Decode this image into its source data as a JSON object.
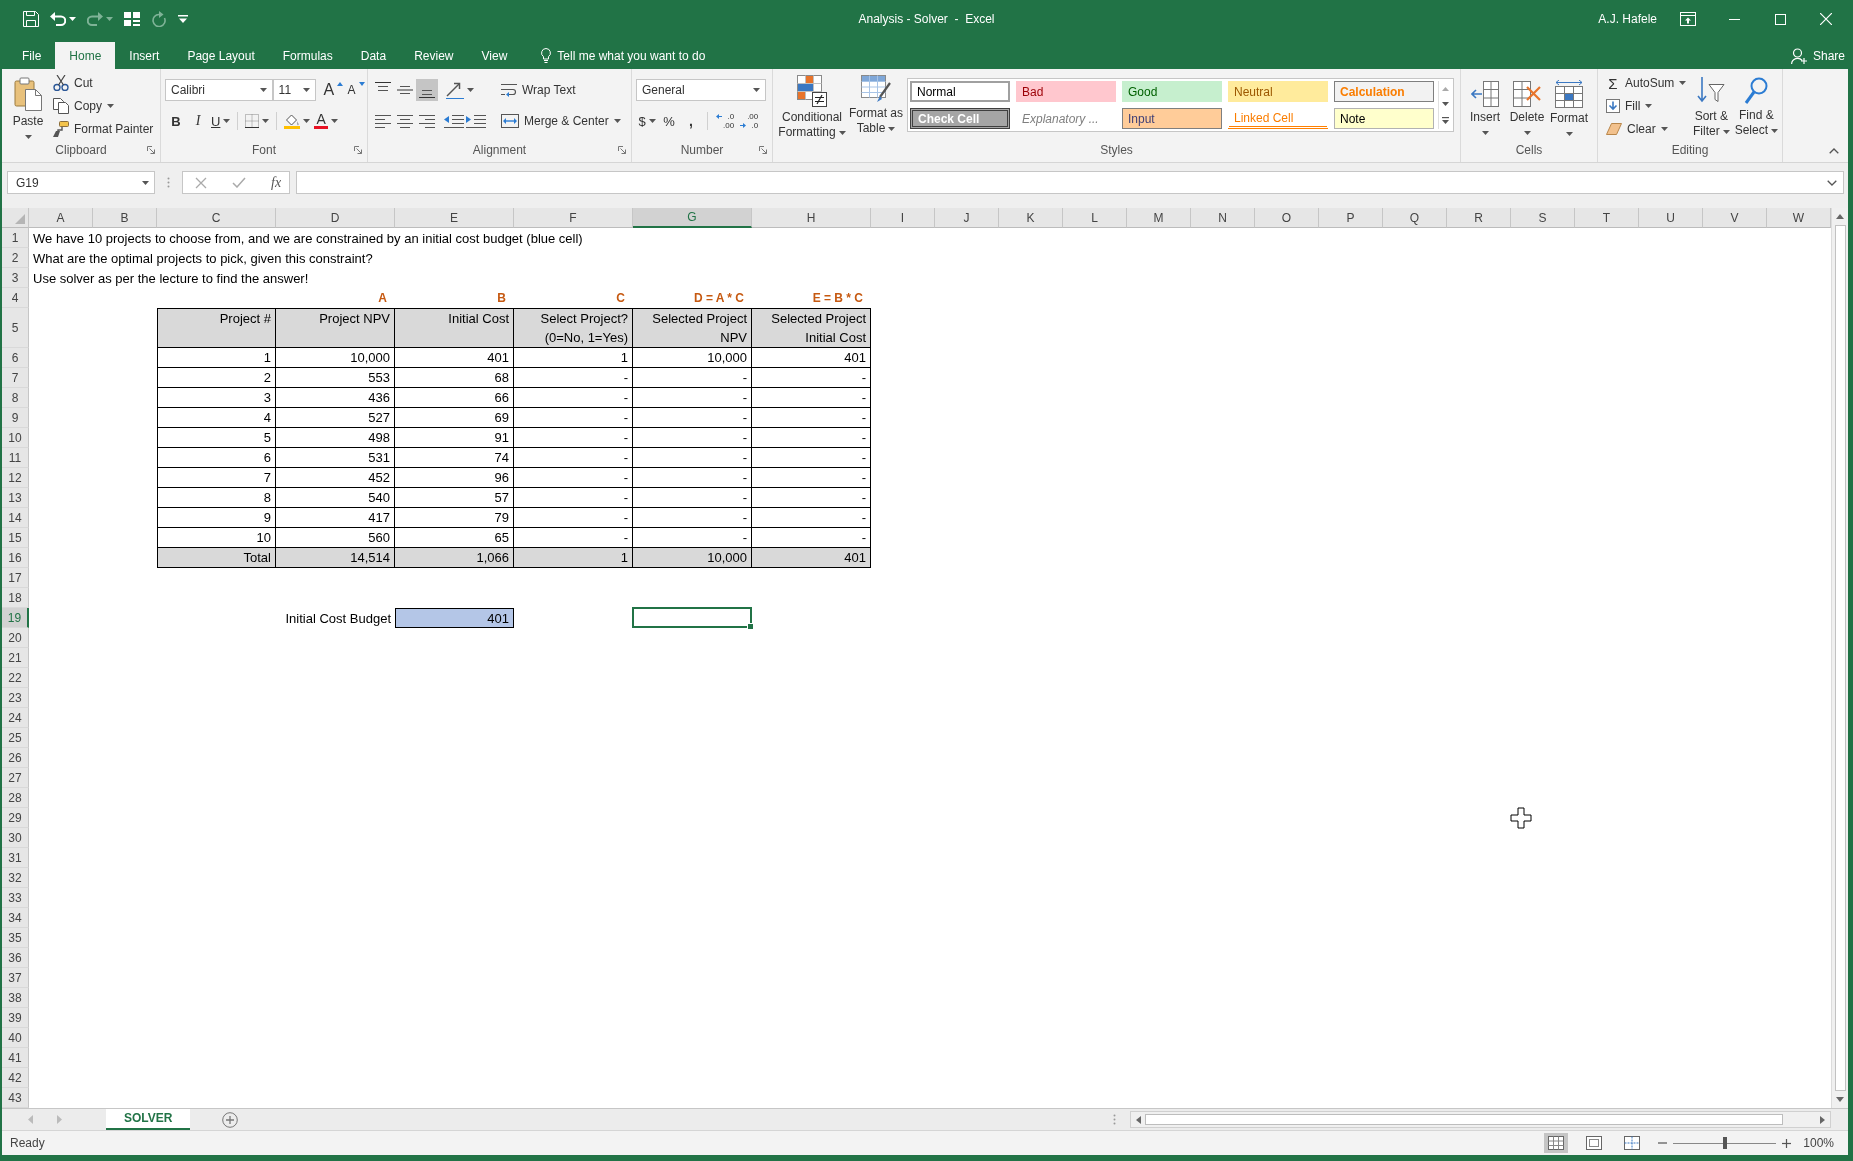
{
  "window": {
    "title": "Analysis - Solver  -  Excel",
    "user": "A.J. Hafele"
  },
  "quick_access": [
    {
      "kind": "save",
      "disabled": false
    },
    {
      "kind": "undo",
      "disabled": false
    },
    {
      "kind": "redo",
      "disabled": true
    },
    {
      "kind": "touch",
      "disabled": false
    },
    {
      "kind": "repeat",
      "disabled": true
    },
    {
      "kind": "customize",
      "disabled": false
    }
  ],
  "ribbon_tabs": [
    {
      "label": "File",
      "selected": false
    },
    {
      "label": "Home",
      "selected": true
    },
    {
      "label": "Insert",
      "selected": false
    },
    {
      "label": "Page Layout",
      "selected": false
    },
    {
      "label": "Formulas",
      "selected": false
    },
    {
      "label": "Data",
      "selected": false
    },
    {
      "label": "Review",
      "selected": false
    },
    {
      "label": "View",
      "selected": false
    }
  ],
  "tell_me": {
    "placeholder": "Tell me what you want to do"
  },
  "share": "Share",
  "ribbon": {
    "clipboard": {
      "label": "Clipboard",
      "paste": "Paste",
      "cut": "Cut",
      "copy": "Copy",
      "format_painter": "Format Painter"
    },
    "font": {
      "label": "Font",
      "font_name": "Calibri",
      "font_size": "11",
      "grow_font": "A",
      "shrink_font": "A",
      "bold": "B",
      "italic": "I",
      "underline": "U",
      "font_color": "A"
    },
    "alignment": {
      "label": "Alignment",
      "vertical": [
        {
          "kind": "top",
          "selected": false
        },
        {
          "kind": "middle",
          "selected": false
        },
        {
          "kind": "bottom",
          "selected": true
        }
      ],
      "horizontal": [
        {
          "kind": "left",
          "selected": false
        },
        {
          "kind": "center",
          "selected": false
        },
        {
          "kind": "right",
          "selected": false
        }
      ],
      "wrap_text": "Wrap Text",
      "merge_center": "Merge & Center"
    },
    "number": {
      "label": "Number",
      "format": "General",
      "currency": "$",
      "percent": "%",
      "comma": ",",
      "increase_decimal": [
        ".0",
        ".00"
      ],
      "decrease_decimal": [
        ".00",
        ".0"
      ]
    },
    "styles": {
      "label": "Styles",
      "conditional_formatting": "Conditional Formatting",
      "format_as_table": "Format as Table",
      "gallery": [
        {
          "label": "Normal",
          "kind": "normal",
          "selected": true
        },
        {
          "label": "Bad",
          "kind": "bad",
          "selected": false
        },
        {
          "label": "Good",
          "kind": "good",
          "selected": false
        },
        {
          "label": "Neutral",
          "kind": "neutral",
          "selected": false
        },
        {
          "label": "Calculation",
          "kind": "calculation",
          "selected": false
        },
        {
          "label": "Check Cell",
          "kind": "check",
          "selected": false
        },
        {
          "label": "Explanatory ...",
          "kind": "explanatory",
          "selected": false
        },
        {
          "label": "Input",
          "kind": "input",
          "selected": false
        },
        {
          "label": "Linked Cell",
          "kind": "linked",
          "selected": false
        },
        {
          "label": "Note",
          "kind": "note",
          "selected": false
        }
      ]
    },
    "cells": {
      "label": "Cells",
      "buttons": [
        {
          "kind": "insert",
          "label": "Insert"
        },
        {
          "kind": "delete",
          "label": "Delete"
        },
        {
          "kind": "format",
          "label": "Format"
        }
      ]
    },
    "editing": {
      "label": "Editing",
      "autosum_symbol": "Σ",
      "autosum": "AutoSum",
      "fill": "Fill",
      "clear": "Clear",
      "sort_filter": "Sort & Filter",
      "find_select": "Find & Select"
    }
  },
  "formula_bar": {
    "name_box": "G19",
    "function_button": "fx"
  },
  "sheet": {
    "columns": [
      {
        "label": "A",
        "selected": false
      },
      {
        "label": "B",
        "selected": false
      },
      {
        "label": "C",
        "selected": false
      },
      {
        "label": "D",
        "selected": false
      },
      {
        "label": "E",
        "selected": false
      },
      {
        "label": "F",
        "selected": false
      },
      {
        "label": "G",
        "selected": true
      },
      {
        "label": "H",
        "selected": false
      },
      {
        "label": "I",
        "selected": false
      },
      {
        "label": "J",
        "selected": false
      },
      {
        "label": "K",
        "selected": false
      },
      {
        "label": "L",
        "selected": false
      },
      {
        "label": "M",
        "selected": false
      },
      {
        "label": "N",
        "selected": false
      },
      {
        "label": "O",
        "selected": false
      },
      {
        "label": "P",
        "selected": false
      },
      {
        "label": "Q",
        "selected": false
      },
      {
        "label": "R",
        "selected": false
      },
      {
        "label": "S",
        "selected": false
      },
      {
        "label": "T",
        "selected": false
      },
      {
        "label": "U",
        "selected": false
      },
      {
        "label": "V",
        "selected": false
      },
      {
        "label": "W",
        "selected": false
      }
    ],
    "rows": [
      {
        "label": "1",
        "selected": false
      },
      {
        "label": "2",
        "selected": false
      },
      {
        "label": "3",
        "selected": false
      },
      {
        "label": "4",
        "selected": false
      },
      {
        "label": "5",
        "selected": false
      },
      {
        "label": "6",
        "selected": false
      },
      {
        "label": "7",
        "selected": false
      },
      {
        "label": "8",
        "selected": false
      },
      {
        "label": "9",
        "selected": false
      },
      {
        "label": "10",
        "selected": false
      },
      {
        "label": "11",
        "selected": false
      },
      {
        "label": "12",
        "selected": false
      },
      {
        "label": "13",
        "selected": false
      },
      {
        "label": "14",
        "selected": false
      },
      {
        "label": "15",
        "selected": false
      },
      {
        "label": "16",
        "selected": false
      },
      {
        "label": "17",
        "selected": false
      },
      {
        "label": "18",
        "selected": false
      },
      {
        "label": "19",
        "selected": true
      },
      {
        "label": "20",
        "selected": false
      },
      {
        "label": "21",
        "selected": false
      },
      {
        "label": "22",
        "selected": false
      },
      {
        "label": "23",
        "selected": false
      },
      {
        "label": "24",
        "selected": false
      },
      {
        "label": "25",
        "selected": false
      },
      {
        "label": "26",
        "selected": false
      },
      {
        "label": "27",
        "selected": false
      },
      {
        "label": "28",
        "selected": false
      },
      {
        "label": "29",
        "selected": false
      },
      {
        "label": "30",
        "selected": false
      },
      {
        "label": "31",
        "selected": false
      },
      {
        "label": "32",
        "selected": false
      },
      {
        "label": "33",
        "selected": false
      },
      {
        "label": "34",
        "selected": false
      },
      {
        "label": "35",
        "selected": false
      },
      {
        "label": "36",
        "selected": false
      },
      {
        "label": "37",
        "selected": false
      },
      {
        "label": "38",
        "selected": false
      },
      {
        "label": "39",
        "selected": false
      },
      {
        "label": "40",
        "selected": false
      },
      {
        "label": "41",
        "selected": false
      },
      {
        "label": "42",
        "selected": false
      },
      {
        "label": "43",
        "selected": false
      }
    ],
    "notes": [
      "We have 10 projects to choose from, and we are constrained by an initial cost budget (blue cell)",
      "What are the optimal projects to pick, given this constraint?",
      "Use solver as per the lecture to find the answer!"
    ],
    "table": {
      "columns": [
        {
          "heading": [
            "Project #"
          ]
        },
        {
          "formula": "A",
          "heading": [
            "Project NPV"
          ]
        },
        {
          "formula": "B",
          "heading": [
            "Initial Cost"
          ]
        },
        {
          "formula": "C",
          "heading": [
            "Select Project?",
            "(0=No, 1=Yes)"
          ]
        },
        {
          "formula": "D = A * C",
          "heading": [
            "Selected Project",
            "NPV"
          ]
        },
        {
          "formula": "E = B * C",
          "heading": [
            "Selected Project",
            "Initial Cost"
          ]
        }
      ],
      "rows": [
        [
          "1",
          "10,000",
          "401",
          "1",
          "10,000",
          "401"
        ],
        [
          "2",
          "553",
          "68",
          "-",
          "-",
          "-"
        ],
        [
          "3",
          "436",
          "66",
          "-",
          "-",
          "-"
        ],
        [
          "4",
          "527",
          "69",
          "-",
          "-",
          "-"
        ],
        [
          "5",
          "498",
          "91",
          "-",
          "-",
          "-"
        ],
        [
          "6",
          "531",
          "74",
          "-",
          "-",
          "-"
        ],
        [
          "7",
          "452",
          "96",
          "-",
          "-",
          "-"
        ],
        [
          "8",
          "540",
          "57",
          "-",
          "-",
          "-"
        ],
        [
          "9",
          "417",
          "79",
          "-",
          "-",
          "-"
        ],
        [
          "10",
          "560",
          "65",
          "-",
          "-",
          "-"
        ]
      ],
      "total": [
        "Total",
        "14,514",
        "1,066",
        "1",
        "10,000",
        "401"
      ]
    },
    "budget": {
      "label": "Initial Cost Budget",
      "value": "401"
    }
  },
  "sheet_tabs": [
    {
      "label": "SOLVER",
      "selected": true
    }
  ],
  "status_bar": {
    "status": "Ready",
    "views": [
      {
        "kind": "normal",
        "selected": true
      },
      {
        "kind": "page_layout",
        "selected": false
      },
      {
        "kind": "page_break",
        "selected": false
      }
    ],
    "zoom_slider": {
      "level": 0.5
    },
    "zoom": "100%"
  }
}
